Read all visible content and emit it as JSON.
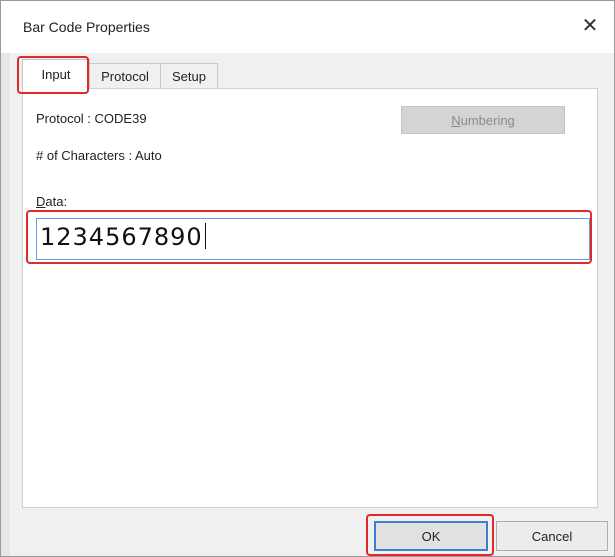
{
  "window": {
    "title": "Bar Code Properties",
    "close_glyph": "✕"
  },
  "tabs": [
    {
      "label": "Input",
      "active": true
    },
    {
      "label": "Protocol",
      "active": false
    },
    {
      "label": "Setup",
      "active": false
    }
  ],
  "input_tab": {
    "protocol_text": "Protocol : CODE39",
    "characters_text": "# of Characters : Auto",
    "numbering_label_prefix": "N",
    "numbering_label_rest": "umbering",
    "numbering_enabled": false,
    "data_label_prefix": "D",
    "data_label_rest": "ata:",
    "data_value": "1234567890"
  },
  "footer": {
    "ok_label": "OK",
    "cancel_label": "Cancel"
  },
  "annotation_color": "#e0282d"
}
